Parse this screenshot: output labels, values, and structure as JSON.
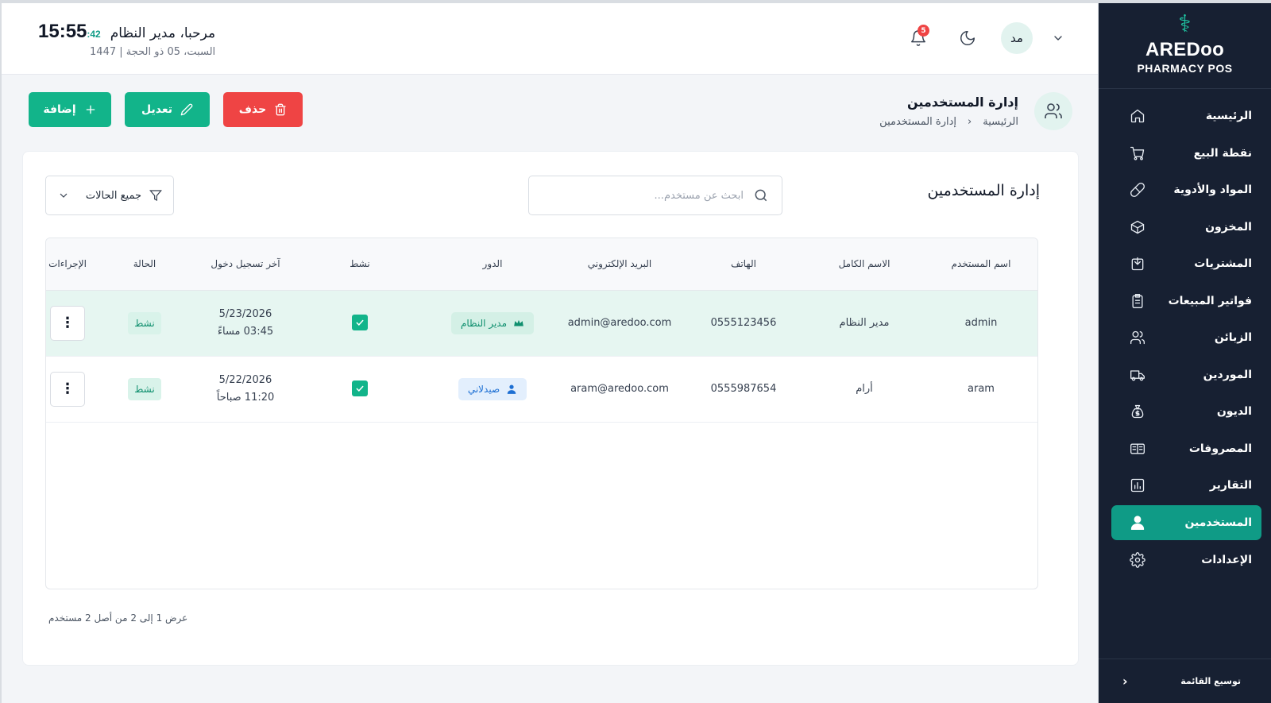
{
  "header": {
    "clock_time": "15:55",
    "clock_seconds": ":42",
    "welcome": "مرحبا، مدير النظام",
    "date": "السبت، 05 ذو الحجة | 1447",
    "notification_count": "5",
    "avatar_initials": "مد"
  },
  "sidebar": {
    "brand_name": "AREDoo",
    "brand_sub": "PHARMACY POS",
    "items": [
      {
        "label": "الرئيسية",
        "icon": "home-icon"
      },
      {
        "label": "نقطة البيع",
        "icon": "cart-icon"
      },
      {
        "label": "المواد والأدوية",
        "icon": "pill-icon"
      },
      {
        "label": "المخزون",
        "icon": "box-icon"
      },
      {
        "label": "المشتريات",
        "icon": "purchase-icon"
      },
      {
        "label": "فواتير المبيعات",
        "icon": "invoice-icon"
      },
      {
        "label": "الزبائن",
        "icon": "users-icon"
      },
      {
        "label": "الموردين",
        "icon": "truck-icon"
      },
      {
        "label": "الديون",
        "icon": "money-bag-icon"
      },
      {
        "label": "المصروفات",
        "icon": "wallet-icon"
      },
      {
        "label": "التقارير",
        "icon": "chart-icon"
      },
      {
        "label": "المستخدمين",
        "icon": "user-icon",
        "active": true
      },
      {
        "label": "الإعدادات",
        "icon": "gear-icon"
      }
    ],
    "expand_label": "توسيع القائمة"
  },
  "page": {
    "title": "إدارة المستخدمين",
    "breadcrumb_home": "الرئيسية",
    "breadcrumb_current": "إدارة المستخدمين",
    "delete_label": "حذف",
    "edit_label": "تعديل",
    "add_label": "إضافة"
  },
  "card": {
    "title": "إدارة المستخدمين",
    "search_placeholder": "ابحث عن مستخدم...",
    "filter_label": "جميع الحالات",
    "footer": "عرض 1 إلى 2 من أصل 2 مستخدم"
  },
  "table": {
    "headers": {
      "username": "اسم المستخدم",
      "fullname": "الاسم الكامل",
      "phone": "الهاتف",
      "email": "البريد الإلكتروني",
      "role": "الدور",
      "active": "نشط",
      "last_login": "آخر تسجيل دخول",
      "status": "الحالة",
      "actions": "الإجراءات"
    },
    "rows": [
      {
        "username": "admin",
        "fullname": "مدير النظام",
        "phone": "0555123456",
        "email": "admin@aredoo.com",
        "role": "مدير النظام",
        "last_login_date": "5/23/2026",
        "last_login_time": "03:45 مساءً",
        "status": "نشط"
      },
      {
        "username": "aram",
        "fullname": "أرام",
        "phone": "0555987654",
        "email": "aram@aredoo.com",
        "role": "صيدلاني",
        "last_login_date": "5/22/2026",
        "last_login_time": "11:20 صباحاً",
        "status": "نشط"
      }
    ]
  },
  "colors": {
    "sidebar_bg": "#172032",
    "accent": "#0f9b86",
    "success": "#12b48a",
    "danger": "#ef4444"
  }
}
